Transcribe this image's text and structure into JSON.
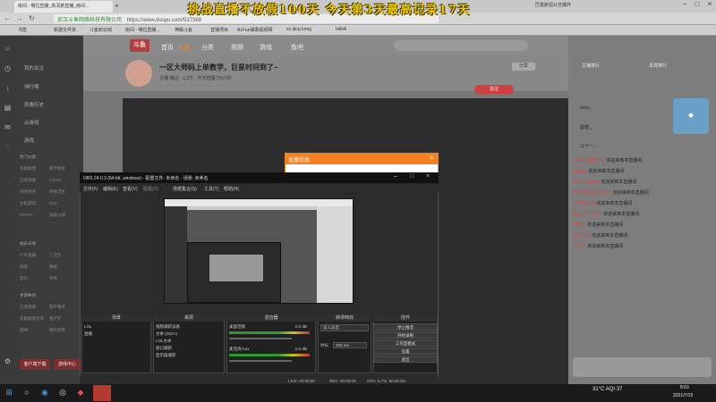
{
  "banner": "挑战直播不放假100天 今天第3天最高记录17天",
  "browser": {
    "tab_title": "房间 - 哪位直播_高清斯直播_房间...",
    "url_prefix": "武汉斗鱼网络科技有限公司",
    "url": "https://www.douyu.com/537388",
    "right_tab": "巴基斯坦公交爆炸",
    "bookmarks": [
      "书签",
      "新建文件夹",
      "斗鱼知识城",
      "房间 - 哪位直播...",
      "神蟑斗鱼",
      "直播项目",
      "AcFun弹幕视频网",
      "xx qing kong",
      "bilibili"
    ]
  },
  "sidebar": {
    "items": [
      "我的关注",
      "排行榜",
      "观看历史",
      "云游戏",
      "游戏"
    ],
    "grid_header1": "热门分类",
    "grid1": [
      "英雄联盟",
      "和平精英",
      "王者荣耀",
      "CSGO",
      "剑侠世界",
      "绝地求生",
      "主机游戏",
      "DNF",
      "DOTA2",
      "穿越火线"
    ],
    "grid_header2": "娱乐天地",
    "grid2": [
      "户外直播",
      "二次元",
      "颜值",
      "舞蹈",
      "音乐",
      "星秀"
    ],
    "grid_header3": "手游休闲",
    "grid3": [
      "王者荣耀",
      "和平精英",
      "英雄联盟手游",
      "金铲铲",
      "原神",
      "我的世界"
    ],
    "download": "客户端下载",
    "games": "游戏中心"
  },
  "nav": {
    "logo": "斗鱼",
    "items": [
      "首页",
      "直播",
      "分类",
      "视频",
      "游戏",
      "鱼吧"
    ]
  },
  "room": {
    "title": "一区大师码上单教学，巨星时间到了~",
    "meta": "主播·猪边 · 1.2万 · 今天直播了5小时",
    "follow": "关注",
    "share": "分享"
  },
  "dialog": {
    "title": "直播信息"
  },
  "obs": {
    "title": "OBS 24.0.3 (64-bit, windows) - 配置文件: 未命名 - 场景: 未命名",
    "menu": [
      "文件(F)",
      "编辑(E)",
      "查看(V)",
      "配置(O)",
      "场景集合(S)",
      "工具(T)",
      "帮助(H)"
    ],
    "docks": {
      "scenes": "场景",
      "sources": "来源",
      "mixer": "混音器",
      "transitions": "转场特效",
      "controls": "控件"
    },
    "scenes": [
      "LOL",
      "直播"
    ],
    "sources": [
      "视频捕获设备",
      "文本 (GDI+)",
      "LOL文本",
      "窗口捕获",
      "显示器捕获"
    ],
    "mixer": [
      {
        "name": "桌面音频",
        "db": "0.0 dB"
      },
      {
        "name": "麦克风/Aux",
        "db": "0.0 dB"
      }
    ],
    "transition_type": "淡入淡出",
    "duration_label": "时长",
    "duration_value": "300 ms",
    "controls": [
      "停止推流",
      "开始录制",
      "工作室模式",
      "设置",
      "退出"
    ],
    "status": {
      "live": "LIVE: 00:00:00",
      "rec": "REC: 00:00:00",
      "cpu": "CPU: 0.7%, 60.00 fps"
    }
  },
  "right": {
    "rank_tabs": [
      "主播排行",
      "贵宾排行"
    ],
    "top_users": [
      "zuzu...",
      "瑟瑟_...",
      "三十一..."
    ],
    "chat": [
      {
        "name": "分享直播间5442",
        "msg": "欢迎来到本直播间"
      },
      {
        "name": "abcz29",
        "msg": "欢迎来到本直播间"
      },
      {
        "name": "用户名称未来",
        "msg": "欢迎来到本直播间"
      },
      {
        "name": "哔哩哔哩拉拉拉144",
        "msg": "欢迎来到本直播间"
      },
      {
        "name": "不朽的小仙",
        "msg": "欢迎来到本直播间"
      },
      {
        "name": "欢迎王中王大1",
        "msg": "欢迎来到本直播间"
      },
      {
        "name": "谢谢了",
        "msg": "欢迎来到本直播间"
      },
      {
        "name": "你的可能",
        "msg": "欢迎来到本直播间"
      },
      {
        "name": "吾一代",
        "msg": "欢迎来到本直播间"
      }
    ]
  },
  "taskbar": {
    "weather": "31°C AQI 37",
    "time": "8:03",
    "date": "2021/7/15"
  }
}
